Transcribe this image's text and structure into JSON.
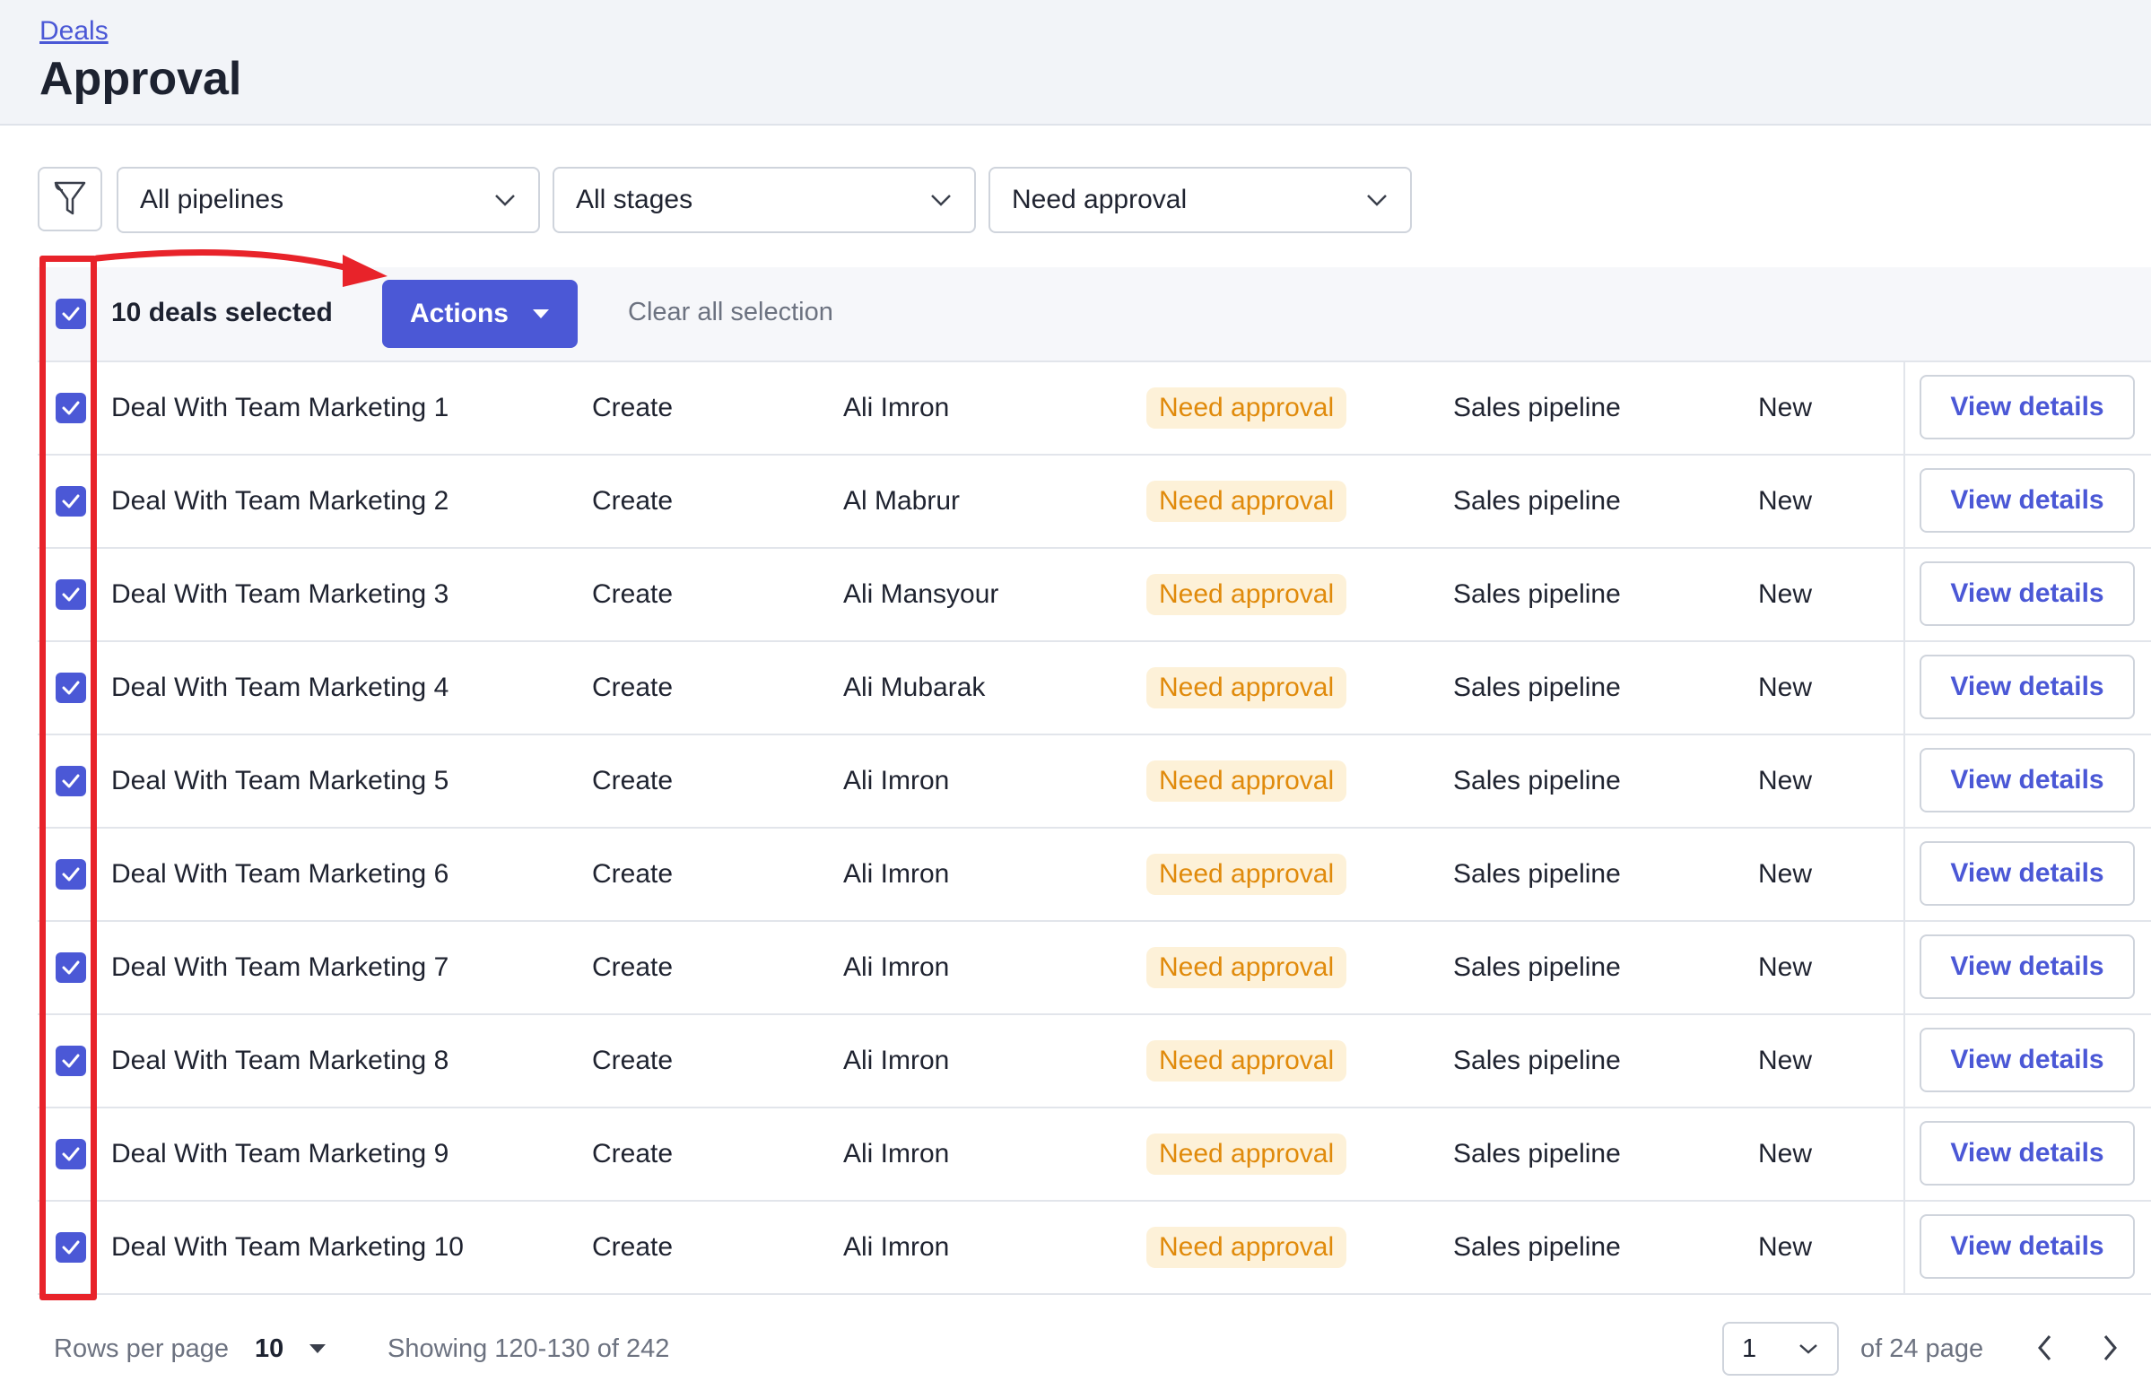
{
  "header": {
    "breadcrumb": "Deals",
    "title": "Approval"
  },
  "filters": {
    "icon": "filter-icon",
    "pipeline": "All pipelines",
    "stage": "All stages",
    "status": "Need approval"
  },
  "selection": {
    "count_label": "10 deals selected",
    "actions_label": "Actions",
    "clear_label": "Clear all selection"
  },
  "rows": [
    {
      "name": "Deal With Team Marketing 1",
      "type": "Create",
      "user": "Ali Imron",
      "status": "Need approval",
      "pipeline": "Sales pipeline",
      "stage": "New",
      "action": "View details"
    },
    {
      "name": "Deal With Team Marketing 2",
      "type": "Create",
      "user": "Al Mabrur",
      "status": "Need approval",
      "pipeline": "Sales pipeline",
      "stage": "New",
      "action": "View details"
    },
    {
      "name": "Deal With Team Marketing 3",
      "type": "Create",
      "user": "Ali Mansyour",
      "status": "Need approval",
      "pipeline": "Sales pipeline",
      "stage": "New",
      "action": "View details"
    },
    {
      "name": "Deal With Team Marketing 4",
      "type": "Create",
      "user": "Ali Mubarak",
      "status": "Need approval",
      "pipeline": "Sales pipeline",
      "stage": "New",
      "action": "View details"
    },
    {
      "name": "Deal With Team Marketing 5",
      "type": "Create",
      "user": "Ali Imron",
      "status": "Need approval",
      "pipeline": "Sales pipeline",
      "stage": "New",
      "action": "View details"
    },
    {
      "name": "Deal With Team Marketing 6",
      "type": "Create",
      "user": "Ali Imron",
      "status": "Need approval",
      "pipeline": "Sales pipeline",
      "stage": "New",
      "action": "View details"
    },
    {
      "name": "Deal With Team Marketing 7",
      "type": "Create",
      "user": "Ali Imron",
      "status": "Need approval",
      "pipeline": "Sales pipeline",
      "stage": "New",
      "action": "View details"
    },
    {
      "name": "Deal With Team Marketing 8",
      "type": "Create",
      "user": "Ali Imron",
      "status": "Need approval",
      "pipeline": "Sales pipeline",
      "stage": "New",
      "action": "View details"
    },
    {
      "name": "Deal With Team Marketing 9",
      "type": "Create",
      "user": "Ali Imron",
      "status": "Need approval",
      "pipeline": "Sales pipeline",
      "stage": "New",
      "action": "View details"
    },
    {
      "name": "Deal With Team Marketing 10",
      "type": "Create",
      "user": "Ali Imron",
      "status": "Need approval",
      "pipeline": "Sales pipeline",
      "stage": "New",
      "action": "View details"
    }
  ],
  "footer": {
    "rows_per_page_label": "Rows per page",
    "rows_per_page_value": "10",
    "showing": "Showing 120-130 of 242",
    "page_value": "1",
    "page_total": "of 24 page"
  },
  "colors": {
    "accent": "#4b58d6",
    "status_text": "#e08a0b",
    "status_bg": "#fdf1d8",
    "annotation": "#e8232a"
  }
}
